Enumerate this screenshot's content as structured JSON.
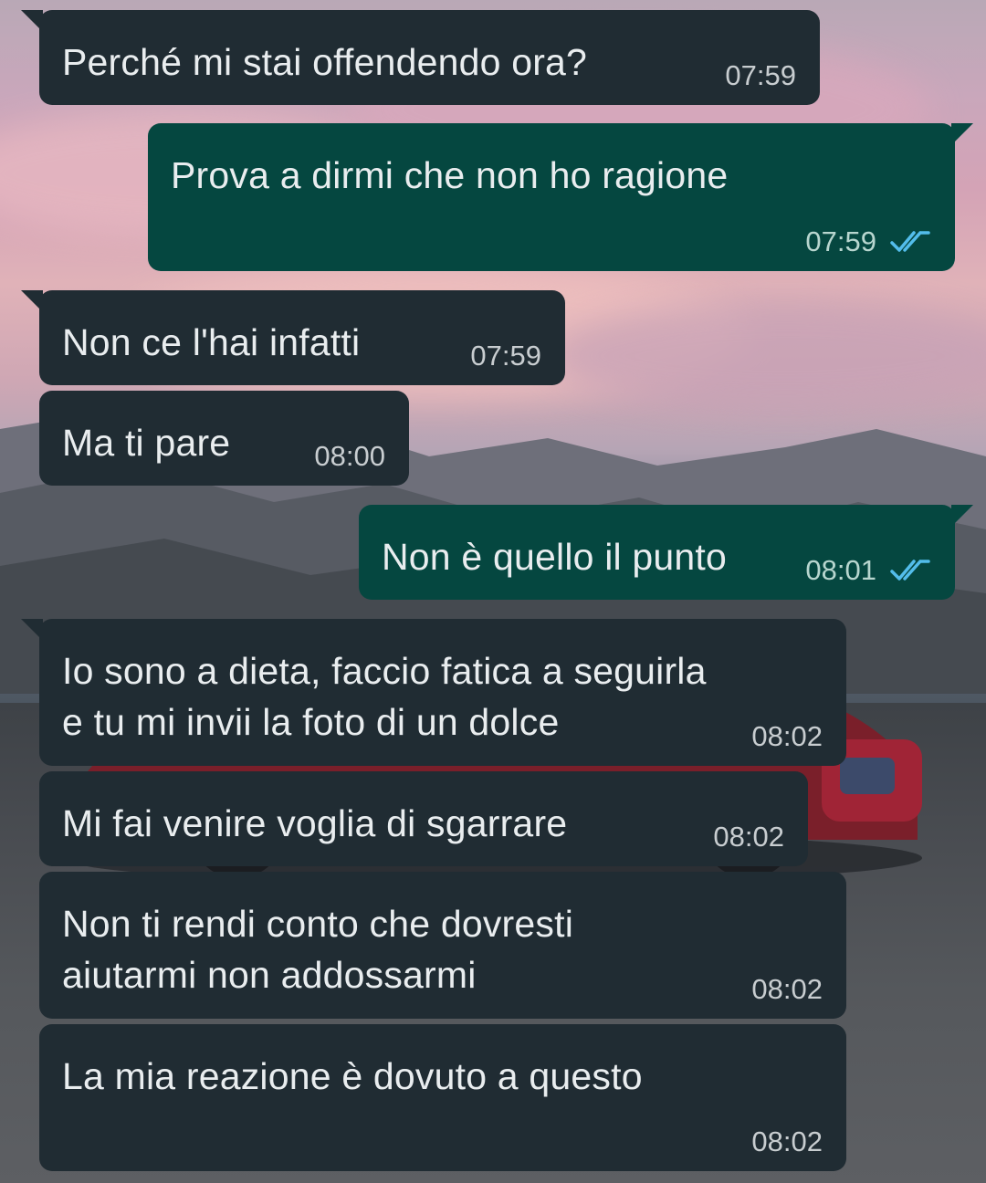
{
  "conversation": {
    "messages": [
      {
        "direction": "incoming",
        "text": "Perché mi stai offendendo ora?",
        "time": "07:59"
      },
      {
        "direction": "outgoing",
        "text": "Prova a dirmi che non ho ragione",
        "time": "07:59",
        "status_icon": "double-check-read-icon"
      },
      {
        "direction": "incoming",
        "text": "Non ce l'hai infatti",
        "time": "07:59"
      },
      {
        "direction": "incoming",
        "text": "Ma ti pare",
        "time": "08:00"
      },
      {
        "direction": "outgoing",
        "text": "Non è quello il punto",
        "time": "08:01",
        "status_icon": "double-check-read-icon"
      },
      {
        "direction": "incoming",
        "text": "Io sono a dieta, faccio fatica a seguirla\ne tu mi invii la foto di un dolce",
        "time": "08:02"
      },
      {
        "direction": "incoming",
        "text": "Mi fai venire voglia di sgarrare",
        "time": "08:02"
      },
      {
        "direction": "incoming",
        "text": "Non ti rendi conto che dovresti\naiutarmi non addossarmi",
        "time": "08:02"
      },
      {
        "direction": "incoming",
        "text": "La mia reazione è dovuto a questo",
        "time": "08:02"
      }
    ]
  },
  "colors": {
    "incoming_bubble": "#202c33",
    "outgoing_bubble": "#054740",
    "message_text": "#e9edef",
    "read_ticks": "#53bdeb"
  }
}
